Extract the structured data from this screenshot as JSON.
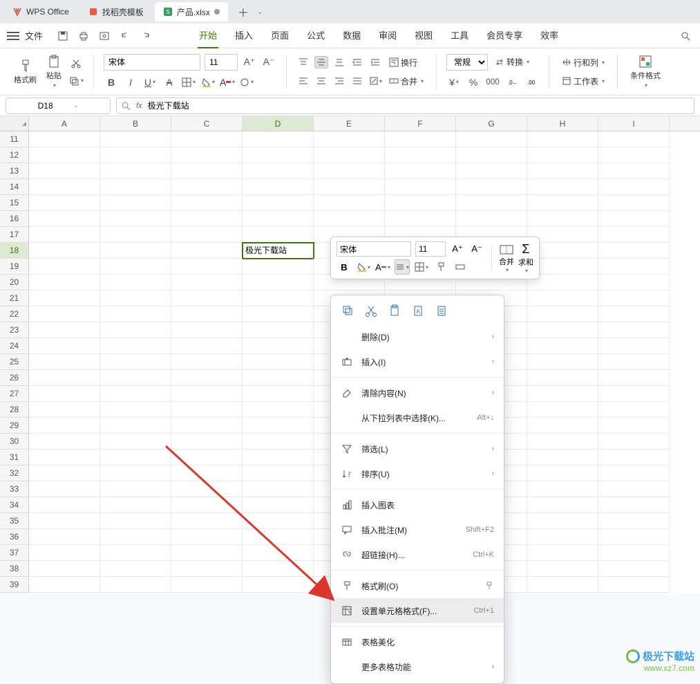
{
  "tabs": {
    "wps": "WPS Office",
    "template": "找稻壳模板",
    "file": "产品.xlsx"
  },
  "menu": {
    "file": "文件",
    "items": [
      "开始",
      "插入",
      "页面",
      "公式",
      "数据",
      "审阅",
      "视图",
      "工具",
      "会员专享",
      "效率"
    ]
  },
  "ribbon": {
    "format_painter": "格式刷",
    "paste": "粘贴",
    "font_name": "宋体",
    "font_size": "11",
    "wrap": "换行",
    "merge": "合并",
    "num_format": "常规",
    "convert": "转换",
    "rows_cols": "行和列",
    "worksheet": "工作表",
    "cond_format": "条件格式"
  },
  "formula": {
    "cell_ref": "D18",
    "content": "极光下载站"
  },
  "columns": [
    "A",
    "B",
    "C",
    "D",
    "E",
    "F",
    "G",
    "H",
    "I"
  ],
  "rows_start": 11,
  "rows_end": 39,
  "selected_cell_value": "极光下载站",
  "mini_toolbar": {
    "font_name": "宋体",
    "font_size": "11",
    "merge": "合并",
    "sum": "求和"
  },
  "context_menu": {
    "delete": "删除(D)",
    "insert": "插入(I)",
    "clear": "清除内容(N)",
    "dropdown_select": "从下拉列表中选择(K)...",
    "dropdown_shortcut": "Alt+↓",
    "filter": "筛选(L)",
    "sort": "排序(U)",
    "insert_chart": "插入图表",
    "insert_comment": "插入批注(M)",
    "comment_shortcut": "Shift+F2",
    "hyperlink": "超链接(H)...",
    "hyperlink_shortcut": "Ctrl+K",
    "format_painter": "格式刷(O)",
    "cell_format": "设置单元格格式(F)...",
    "cell_format_shortcut": "Ctrl+1",
    "beautify": "表格美化",
    "more_funcs": "更多表格功能"
  },
  "watermark": {
    "brand": "极光下载站",
    "url": "www.xz7.com"
  }
}
